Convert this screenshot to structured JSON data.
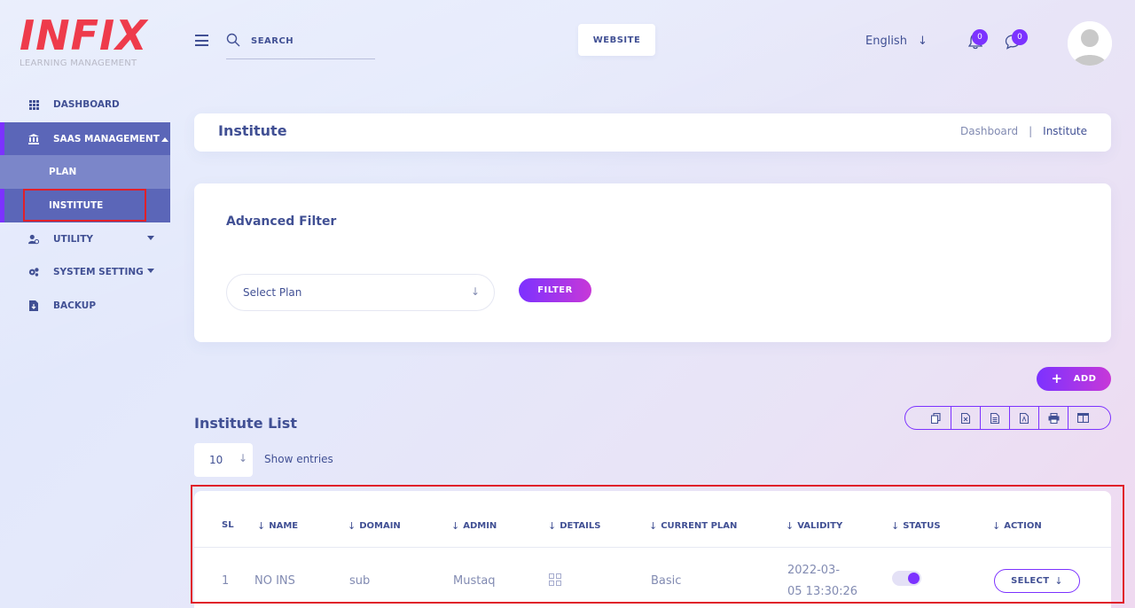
{
  "logo": {
    "main": "INFIX",
    "sub": "LEARNING MANAGEMENT"
  },
  "sidebar": {
    "items": [
      {
        "label": "DASHBOARD",
        "icon": "dashboard-grid-icon"
      },
      {
        "label": "SAAS MANAGEMENT",
        "icon": "bank-icon"
      },
      {
        "label": "PLAN"
      },
      {
        "label": "INSTITUTE"
      },
      {
        "label": "UTILITY",
        "icon": "users-icon"
      },
      {
        "label": "SYSTEM SETTING",
        "icon": "gears-icon"
      },
      {
        "label": "BACKUP",
        "icon": "file-download-icon"
      }
    ]
  },
  "header": {
    "search_label": "SEARCH",
    "website_label": "WEBSITE",
    "language": "English",
    "notification_count": "0",
    "message_count": "0"
  },
  "breadcrumb": {
    "title": "Institute",
    "path": [
      "Dashboard",
      "Institute"
    ],
    "separator": "|"
  },
  "filter": {
    "title": "Advanced Filter",
    "select_placeholder": "Select Plan",
    "button": "FILTER"
  },
  "list": {
    "add_label": "ADD",
    "title": "Institute List",
    "entries_value": "10",
    "entries_label": "Show entries",
    "columns": [
      "SL",
      "NAME",
      "DOMAIN",
      "ADMIN",
      "DETAILS",
      "CURRENT PLAN",
      "VALIDITY",
      "STATUS",
      "ACTION"
    ],
    "rows": [
      {
        "sl": "1",
        "name": "NO INS",
        "domain": "sub",
        "admin": "Mustaq",
        "plan": "Basic",
        "validity_line1": "2022-03-",
        "validity_line2": "05 13:30:26",
        "status_on": true,
        "action": "SELECT"
      }
    ]
  },
  "colors": {
    "primary": "#415094",
    "accent": "#7c32ff",
    "gradient_end": "#c738d8",
    "logo_red": "#ee3b4b",
    "highlight": "#e0202a"
  }
}
